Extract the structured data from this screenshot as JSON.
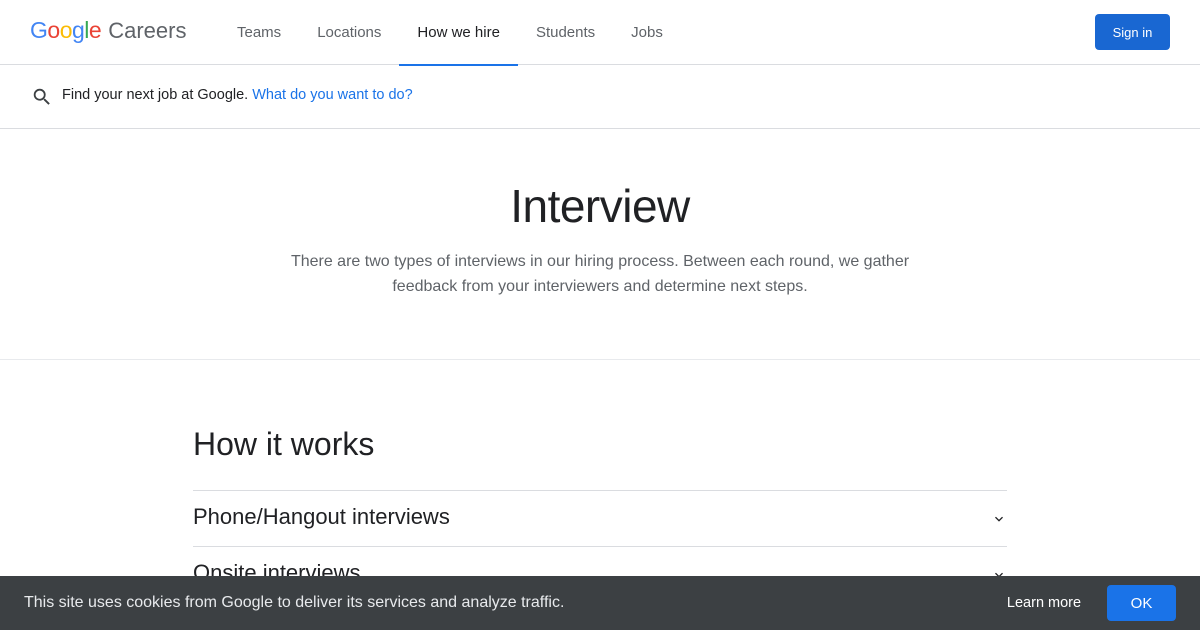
{
  "header": {
    "logo_letters": [
      "G",
      "o",
      "o",
      "g",
      "l",
      "e"
    ],
    "logo_colors": [
      "#4285f4",
      "#ea4335",
      "#fbbc05",
      "#4285f4",
      "#34a853",
      "#ea4335"
    ],
    "logo_suffix": "Careers",
    "nav": [
      {
        "label": "Teams"
      },
      {
        "label": "Locations"
      },
      {
        "label": "How we hire"
      },
      {
        "label": "Students"
      },
      {
        "label": "Jobs"
      }
    ],
    "active_nav": "How we hire",
    "sign_in_label": "Sign in"
  },
  "search": {
    "icon": "search-icon",
    "prompt": "Find your next job at Google.",
    "link": "What do you want to do?"
  },
  "hero": {
    "title": "Interview",
    "description": "There are two types of interviews in our hiring process. Between each round, we gather feedback from your interviewers and determine next steps."
  },
  "how_it_works": {
    "title": "How it works",
    "items": [
      {
        "label": "Phone/Hangout interviews",
        "icon": "chevron-down-icon"
      },
      {
        "label": "Onsite interviews",
        "icon": "chevron-down-icon"
      }
    ]
  },
  "cookie_banner": {
    "text": "This site uses cookies from Google to deliver its services and analyze traffic.",
    "learn_more_label": "Learn more",
    "ok_label": "OK"
  },
  "colors": {
    "accent": "#1a73e8",
    "sign_in_bg": "#1967d2",
    "cookie_bg": "#3c4043"
  }
}
